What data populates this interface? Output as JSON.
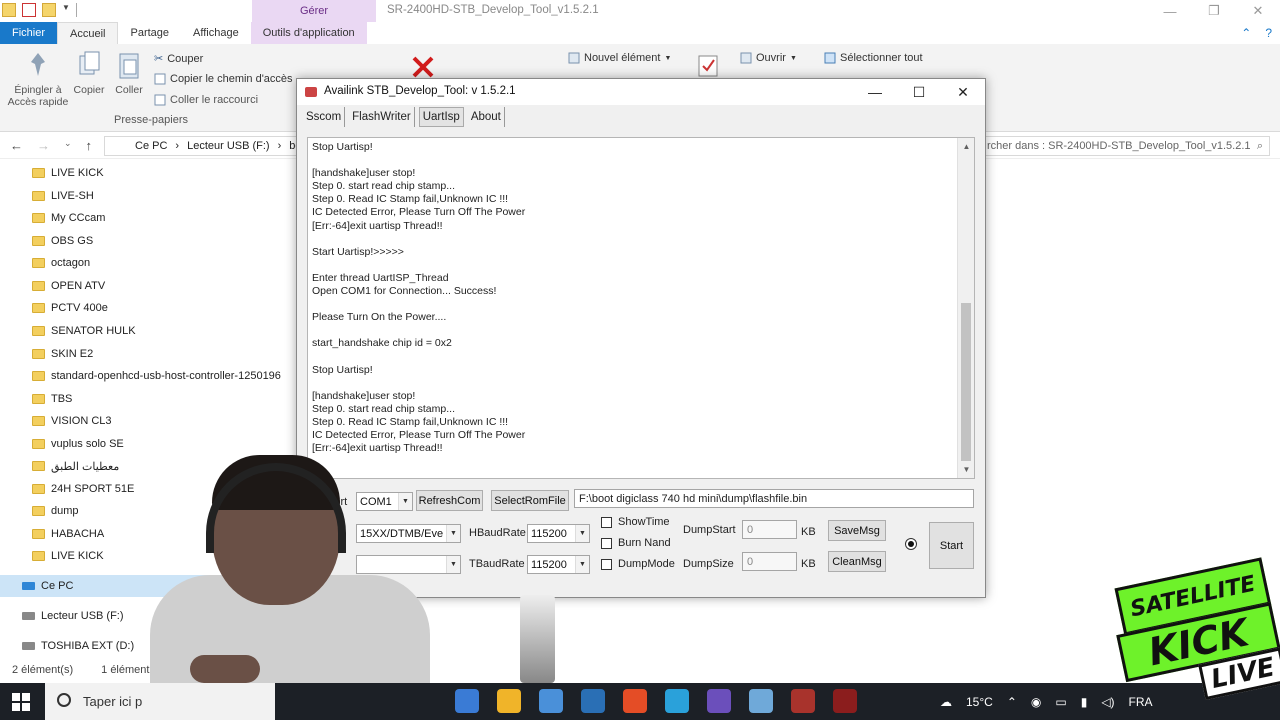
{
  "explorer": {
    "title": "SR-2400HD-STB_Develop_Tool_v1.5.2.1",
    "manage_tab": "Gérer",
    "tabs": [
      "Fichier",
      "Accueil",
      "Partage",
      "Affichage",
      "Outils d'application"
    ],
    "ribbon": {
      "pin_label": "Épingler à\nAccès rapide",
      "copy_label": "Copier",
      "paste_label": "Coller",
      "cut_label": "Couper",
      "copy_path_label": "Copier le chemin d'accès",
      "paste_shortcut_label": "Coller le raccourci",
      "group_clipboard": "Presse-papiers",
      "new_item_label": "Nouvel élément",
      "open_label": "Ouvrir",
      "select_all_label": "Sélectionner tout"
    },
    "breadcrumb": [
      "Ce PC",
      "Lecteur USB (F:)",
      "bo"
    ],
    "search_placeholder": "rcher dans : SR-2400HD-STB_Develop_Tool_v1.5.2.1",
    "sidebar": [
      "LIVE KICK",
      "LIVE-SH",
      "My CCcam",
      "OBS GS",
      "octagon",
      "OPEN ATV",
      "PCTV 400e",
      "SENATOR HULK",
      "SKIN E2",
      "standard-openhcd-usb-host-controller-1250196",
      "TBS",
      "VISION CL3",
      "vuplus solo SE",
      "معطيات الطبق",
      "24H SPORT 51E",
      "dump",
      "HABACHA",
      "LIVE KICK"
    ],
    "this_pc": "Ce PC",
    "drives": [
      "Lecteur USB (F:)",
      "TOSHIBA EXT (D:)"
    ],
    "status_count": "2 élément(s)",
    "status_selected": "1 élément s"
  },
  "app": {
    "title": "Availink STB_Develop_Tool: v 1.5.2.1",
    "menu": [
      "Sscom",
      "FlashWriter",
      "UartIsp",
      "About"
    ],
    "log": "Stop Uartisp!\n\n[handshake]user stop!\nStep 0. start read chip stamp...\nStep 0. Read IC Stamp fail,Unknown IC !!!\nIC Detected Error, Please Turn Off The Power\n[Err:-64]exit uartisp Thread!!\n\nStart Uartisp!>>>>>\n\nEnter thread UartISP_Thread\nOpen COM1 for Connection... Success!\n\nPlease Turn On the Power....\n\nstart_handshake chip id = 0x2\n\nStop Uartisp!\n\n[handshake]user stop!\nStep 0. start read chip stamp...\nStep 0. Read IC Stamp fail,Unknown IC !!!\nIC Detected Error, Please Turn Off The Power\n[Err:-64]exit uartisp Thread!!",
    "port_label": "Port",
    "port_value": "COM1",
    "refresh_label": "RefreshCom",
    "select_rom_label": "SelectRomFile",
    "rom_path": "F:\\boot digiclass 740 hd mini\\dump\\flashfile.bin",
    "chip_value": "15XX/DTMB/Eve",
    "hbaud_label": "HBaudRate",
    "hbaud_value": "115200",
    "tbaud_label": "TBaudRate",
    "tbaud_value": "115200",
    "show_time": "ShowTime",
    "burn_nand": "Burn Nand",
    "dump_mode": "DumpMode",
    "dump_start_label": "DumpStart",
    "dump_start_value": "0",
    "dump_size_label": "DumpSize",
    "dump_size_value": "0",
    "kb": "KB",
    "save_msg": "SaveMsg",
    "clean_msg": "CleanMsg",
    "start": "Start"
  },
  "taskbar": {
    "search_placeholder": "Taper ici p",
    "temp": "15°C",
    "lang": "FRA"
  },
  "brand": {
    "line1": "SATELLITE",
    "line2": "KICK",
    "line3": "LIVE"
  },
  "colors": {
    "file_tab": "#1979ca",
    "manage_tab": "#ead8f3",
    "brand_green": "#6ef22a"
  }
}
